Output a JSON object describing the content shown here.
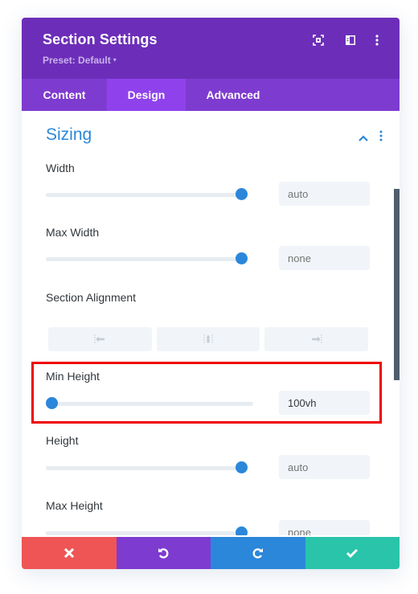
{
  "header": {
    "title": "Section Settings",
    "preset_label": "Preset: Default",
    "preset_caret": "▾",
    "icons": [
      "expand-fullscreen-icon",
      "sidebar-layout-icon",
      "more-options-icon"
    ]
  },
  "tabs": [
    {
      "label": "Content",
      "active": false
    },
    {
      "label": "Design",
      "active": true
    },
    {
      "label": "Advanced",
      "active": false
    }
  ],
  "section": {
    "title": "Sizing",
    "collapsed": false
  },
  "fields": {
    "width": {
      "label": "Width",
      "value": "auto",
      "slider_fraction": 1.0,
      "is_placeholder": true
    },
    "max_width": {
      "label": "Max Width",
      "value": "none",
      "slider_fraction": 1.0,
      "is_placeholder": true
    },
    "section_alignment": {
      "label": "Section Alignment",
      "options": [
        "align-left",
        "align-center",
        "align-right"
      ]
    },
    "min_height": {
      "label": "Min Height",
      "value": "100vh",
      "slider_fraction": 0.0,
      "is_placeholder": false,
      "highlighted": true
    },
    "height": {
      "label": "Height",
      "value": "auto",
      "slider_fraction": 1.0,
      "is_placeholder": true
    },
    "max_height": {
      "label": "Max Height",
      "value": "none",
      "slider_fraction": 1.0,
      "is_placeholder": true
    }
  },
  "footer": {
    "buttons": [
      {
        "name": "cancel",
        "icon": "close-icon",
        "color": "#ef5555"
      },
      {
        "name": "undo",
        "icon": "undo-icon",
        "color": "#7e3bd0"
      },
      {
        "name": "redo",
        "icon": "redo-icon",
        "color": "#2b87da"
      },
      {
        "name": "save",
        "icon": "check-icon",
        "color": "#29c4a9"
      }
    ]
  },
  "colors": {
    "header_bg": "#6c2eb9",
    "tabs_bg": "#7e3bd0",
    "tab_active_bg": "#8f42ec",
    "accent": "#2b87da",
    "highlight_border": "#ee0000"
  }
}
